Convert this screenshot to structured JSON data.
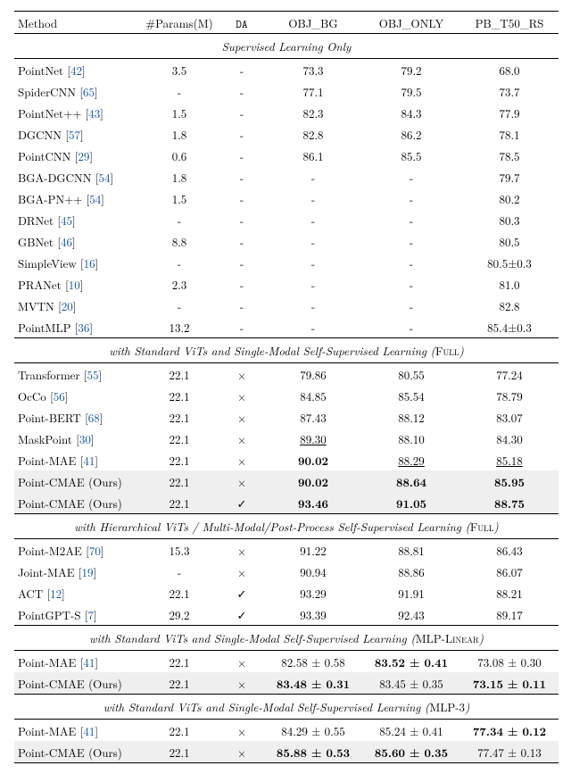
{
  "header": {
    "method": "Method",
    "params": "#Params(M)",
    "da": "DA",
    "obj_bg": "OBJ_BG",
    "obj_only": "OBJ_ONLY",
    "pb": "PB_T50_RS"
  },
  "sections": [
    {
      "title_pre": "Supervised Learning Only",
      "title_suf": "",
      "border_top": false,
      "rows": [
        {
          "method": "PointNet",
          "ref": "42",
          "params": "3.5",
          "da": "-",
          "objbg": "73.3",
          "objonly": "79.2",
          "pb": "68.0"
        },
        {
          "method": "SpiderCNN",
          "ref": "65",
          "params": "-",
          "da": "-",
          "objbg": "77.1",
          "objonly": "79.5",
          "pb": "73.7"
        },
        {
          "method": "PointNet++",
          "ref": "43",
          "params": "1.5",
          "da": "-",
          "objbg": "82.3",
          "objonly": "84.3",
          "pb": "77.9"
        },
        {
          "method": "DGCNN",
          "ref": "57",
          "params": "1.8",
          "da": "-",
          "objbg": "82.8",
          "objonly": "86.2",
          "pb": "78.1"
        },
        {
          "method": "PointCNN",
          "ref": "29",
          "params": "0.6",
          "da": "-",
          "objbg": "86.1",
          "objonly": "85.5",
          "pb": "78.5"
        },
        {
          "method": "BGA-DGCNN",
          "ref": "54",
          "params": "1.8",
          "da": "-",
          "objbg": "-",
          "objonly": "-",
          "pb": "79.7"
        },
        {
          "method": "BGA-PN++",
          "ref": "54",
          "params": "1.5",
          "da": "-",
          "objbg": "-",
          "objonly": "-",
          "pb": "80.2"
        },
        {
          "method": "DRNet",
          "ref": "45",
          "params": "-",
          "da": "-",
          "objbg": "-",
          "objonly": "-",
          "pb": "80.3"
        },
        {
          "method": "GBNet",
          "ref": "46",
          "params": "8.8",
          "da": "-",
          "objbg": "-",
          "objonly": "-",
          "pb": "80.5"
        },
        {
          "method": "SimpleView",
          "ref": "16",
          "params": "-",
          "da": "-",
          "objbg": "-",
          "objonly": "-",
          "pb": "80.5±0.3"
        },
        {
          "method": "PRANet",
          "ref": "10",
          "params": "2.3",
          "da": "-",
          "objbg": "-",
          "objonly": "-",
          "pb": "81.0"
        },
        {
          "method": "MVTN",
          "ref": "20",
          "params": "-",
          "da": "-",
          "objbg": "-",
          "objonly": "-",
          "pb": "82.8"
        },
        {
          "method": "PointMLP",
          "ref": "36",
          "params": "13.2",
          "da": "-",
          "objbg": "-",
          "objonly": "-",
          "pb": "85.4±0.3"
        }
      ]
    },
    {
      "title_pre": "with Standard ViTs and Single-Modal Self-Supervised Learning",
      "title_suf": "Full",
      "border_top": true,
      "rows": [
        {
          "method": "Transformer",
          "ref": "55",
          "params": "22.1",
          "da": "×",
          "objbg": "79.86",
          "objonly": "80.55",
          "pb": "77.24"
        },
        {
          "method": "OcCo",
          "ref": "56",
          "params": "22.1",
          "da": "×",
          "objbg": "84.85",
          "objonly": "85.54",
          "pb": "78.79"
        },
        {
          "method": "Point-BERT",
          "ref": "68",
          "params": "22.1",
          "da": "×",
          "objbg": "87.43",
          "objonly": "88.12",
          "pb": "83.07"
        },
        {
          "method": "MaskPoint",
          "ref": "30",
          "params": "22.1",
          "da": "×",
          "objbg": "89.30",
          "objbg_u": true,
          "objonly": "88.10",
          "pb": "84.30"
        },
        {
          "method": "Point-MAE",
          "ref": "41",
          "params": "22.1",
          "da": "×",
          "objbg": "90.02",
          "objbg_b": true,
          "objonly": "88.29",
          "objonly_u": true,
          "pb": "85.18",
          "pb_u": true
        },
        {
          "method": "Point-CMAE (Ours)",
          "params": "22.1",
          "da": "×",
          "objbg": "90.02",
          "objbg_b": true,
          "objonly": "88.64",
          "objonly_b": true,
          "pb": "85.95",
          "pb_b": true,
          "hl": true
        },
        {
          "method": "Point-CMAE (Ours)",
          "params": "22.1",
          "da": "✓",
          "objbg": "93.46",
          "objbg_b": true,
          "objonly": "91.05",
          "objonly_b": true,
          "pb": "88.75",
          "pb_b": true,
          "hl": true
        }
      ]
    },
    {
      "title_pre": "with Hierarchical ViTs / Multi-Modal/Post-Process Self-Supervised Learning",
      "title_suf": "Full",
      "border_top": true,
      "rows": [
        {
          "method": "Point-M2AE",
          "ref": "70",
          "params": "15.3",
          "da": "×",
          "objbg": "91.22",
          "objonly": "88.81",
          "pb": "86.43"
        },
        {
          "method": "Joint-MAE",
          "ref": "19",
          "params": "-",
          "da": "×",
          "objbg": "90.94",
          "objonly": "88.86",
          "pb": "86.07"
        },
        {
          "method": "ACT",
          "ref": "12",
          "params": "22.1",
          "da": "✓",
          "objbg": "93.29",
          "objonly": "91.91",
          "pb": "88.21"
        },
        {
          "method": "PointGPT-S",
          "ref": "7",
          "params": "29.2",
          "da": "✓",
          "objbg": "93.39",
          "objonly": "92.43",
          "pb": "89.17"
        }
      ]
    },
    {
      "title_pre": "with Standard ViTs and Single-Modal Self-Supervised Learning",
      "title_suf": "MLP-Linear",
      "border_top": true,
      "rows": [
        {
          "method": "Point-MAE",
          "ref": "41",
          "params": "22.1",
          "da": "×",
          "objbg": "82.58 ± 0.58",
          "objonly": "83.52 ± 0.41",
          "objonly_b": true,
          "pb": "73.08 ± 0.30"
        },
        {
          "method": "Point-CMAE (Ours)",
          "params": "22.1",
          "da": "×",
          "objbg": "83.48 ± 0.31",
          "objbg_b": true,
          "objonly": "83.45 ± 0.35",
          "pb": "73.15 ± 0.11",
          "pb_b": true,
          "hl": true
        }
      ]
    },
    {
      "title_pre": "with Standard ViTs and Single-Modal Self-Supervised Learning",
      "title_suf": "MLP-3",
      "border_top": true,
      "rows": [
        {
          "method": "Point-MAE",
          "ref": "41",
          "params": "22.1",
          "da": "×",
          "objbg": "84.29 ± 0.55",
          "objonly": "85.24 ± 0.41",
          "pb": "77.34 ± 0.12",
          "pb_b": true
        },
        {
          "method": "Point-CMAE (Ours)",
          "params": "22.1",
          "da": "×",
          "objbg": "85.88 ± 0.53",
          "objbg_b": true,
          "objonly": "85.60 ± 0.35",
          "objonly_b": true,
          "pb": "77.47 ± 0.13",
          "hl": true
        }
      ]
    }
  ]
}
